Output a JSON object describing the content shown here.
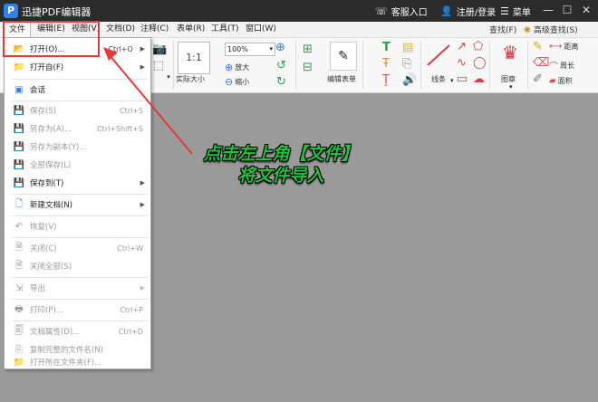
{
  "titlebar": {
    "app_title": "迅捷PDF编辑器",
    "service": "客服入口",
    "account": "注册/登录",
    "menu": "菜单"
  },
  "menubar": {
    "items": [
      "文件",
      "编辑(E)",
      "视图(V)",
      "文档(D)",
      "注释(C)",
      "表单(R)",
      "工具(T)",
      "窗口(W)"
    ],
    "find": "查找(F)",
    "advanced_find": "高级查找(S)"
  },
  "ribbon": {
    "zoom_value": "100%",
    "actual_size": "实际大小",
    "zoom_in": "放大",
    "zoom_out": "缩小",
    "edit_form": "编辑表单",
    "lines": "线条",
    "shape": "图章",
    "distance": "距离",
    "perimeter": "周长",
    "area": "面积"
  },
  "filemenu": {
    "items": [
      {
        "label": "打开(O)...",
        "shortcut": "Ctrl+O",
        "icon": "folder-open-icon"
      },
      {
        "label": "打开自(F)",
        "shortcut": "",
        "icon": "folder-icon"
      },
      {
        "label": "会话",
        "shortcut": "",
        "icon": "session-icon"
      },
      {
        "label": "保存(S)",
        "shortcut": "Ctrl+S",
        "icon": "save-icon"
      },
      {
        "label": "另存为(A)...",
        "shortcut": "Ctrl+Shift+S",
        "icon": "save-as-icon"
      },
      {
        "label": "另存为副本(Y)...",
        "shortcut": "",
        "icon": "save-copy-icon"
      },
      {
        "label": "全部保存(L)",
        "shortcut": "",
        "icon": "save-all-icon"
      },
      {
        "label": "保存到(T)",
        "shortcut": "",
        "icon": "save-to-icon"
      },
      {
        "label": "新建文档(N)",
        "shortcut": "",
        "icon": "new-document-icon"
      },
      {
        "label": "恢复(V)",
        "shortcut": "",
        "icon": "revert-icon"
      },
      {
        "label": "关闭(C)",
        "shortcut": "Ctrl+W",
        "icon": "close-doc-icon"
      },
      {
        "label": "关闭全部(S)",
        "shortcut": "",
        "icon": "close-all-icon"
      },
      {
        "label": "导出",
        "shortcut": "",
        "icon": "export-icon"
      },
      {
        "label": "打印(P)...",
        "shortcut": "Ctrl+P",
        "icon": "print-icon"
      },
      {
        "label": "文档属性(D)...",
        "shortcut": "Ctrl+D",
        "icon": "properties-icon"
      },
      {
        "label": "复制完整的文件名(N)",
        "shortcut": "",
        "icon": "copy-filename-icon"
      },
      {
        "label": "打开所在文件夹(F)...",
        "shortcut": "",
        "icon": "open-folder-icon"
      }
    ]
  },
  "annotation": {
    "line1": "点击左上角【文件】",
    "line2": "将文件导入"
  },
  "colors": {
    "accent": "#e53935",
    "annotation_text": "#22c13a",
    "titlebar": "#2b2b2b",
    "workspace": "#9a9a9a"
  }
}
